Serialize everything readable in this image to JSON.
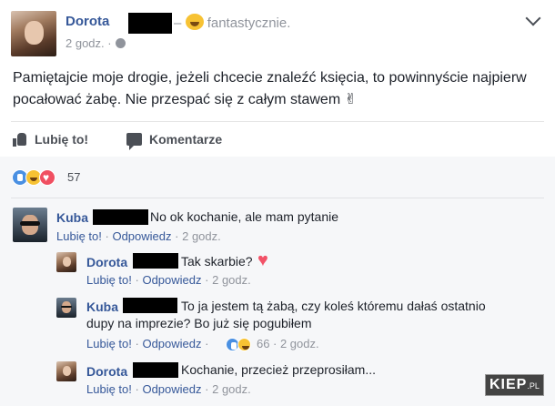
{
  "post": {
    "author": "Dorota",
    "feeling_separator": "–",
    "feeling": "fantastycznie.",
    "time": "2 godz.",
    "text": "Pamiętajcie moje drogie, jeżeli chcecie znaleźć księcia, to powinnyście najpierw pocałować żabę. Nie przespać się z całym stawem",
    "text_emoji": "✌",
    "actions": {
      "like": "Lubię to!",
      "comment": "Komentarze"
    },
    "reactions_count": "57"
  },
  "comments": [
    {
      "author": "Kuba",
      "text": "No ok kochanie, ale mam pytanie",
      "like": "Lubię to!",
      "reply": "Odpowiedz",
      "time": "2 godz."
    },
    {
      "author": "Dorota",
      "text": "Tak skarbie?",
      "emoji": "♥",
      "like": "Lubię to!",
      "reply": "Odpowiedz",
      "time": "2 godz."
    },
    {
      "author": "Kuba",
      "text_line1": "To ja jestem tą żabą, czy koleś któremu dałaś ostatnio",
      "text_line2": "dupy na imprezie? Bo już się pogubiłem",
      "like": "Lubię to!",
      "reply": "Odpowiedz",
      "reaction_count": "66",
      "time": "2 godz."
    },
    {
      "author": "Dorota",
      "text": "Kochanie, przecież przeprosiłam...",
      "like": "Lubię to!",
      "reply": "Odpowiedz",
      "time": "2 godz."
    }
  ],
  "separator": "·",
  "watermark": {
    "main": "KIEP",
    "tld": ".PL"
  },
  "colors": {
    "link": "#365899",
    "meta": "#90949c",
    "like_blue": "#4a90e2",
    "love_red": "#f04f61",
    "haha_yellow": "#f7c233"
  }
}
